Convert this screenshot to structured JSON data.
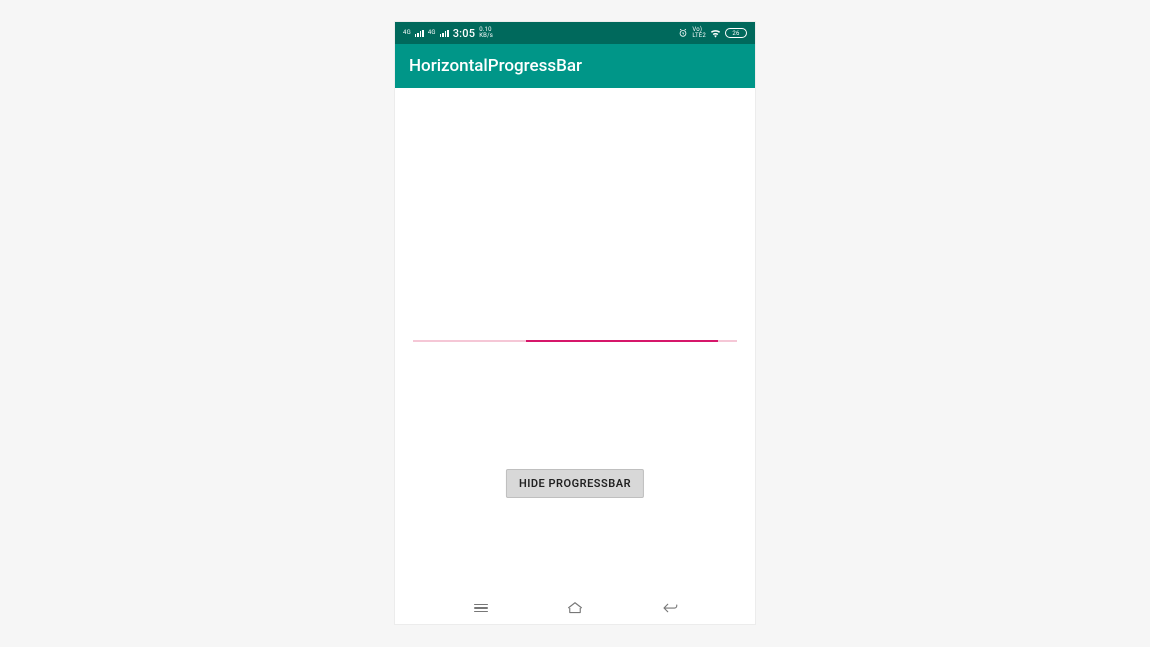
{
  "statusbar": {
    "signal_label_1": "4G",
    "signal_label_2": "4G",
    "clock": "3:05",
    "data_rate_top": "0.10",
    "data_rate_bottom": "KB/s",
    "volte_top": "Vo)",
    "volte_bottom": "LTE2",
    "battery_text": "26"
  },
  "appbar": {
    "title": "HorizontalProgressBar"
  },
  "progress": {
    "segment_left_pct": 35,
    "segment_width_pct": 59
  },
  "button": {
    "label": "HIDE PROGRESSBAR"
  },
  "colors": {
    "status_bg": "#00695c",
    "appbar_bg": "#009688",
    "progress_track": "rgba(216,32,90,0.25)",
    "progress_fill": "#d6166a",
    "button_bg": "#d8d8d8"
  }
}
